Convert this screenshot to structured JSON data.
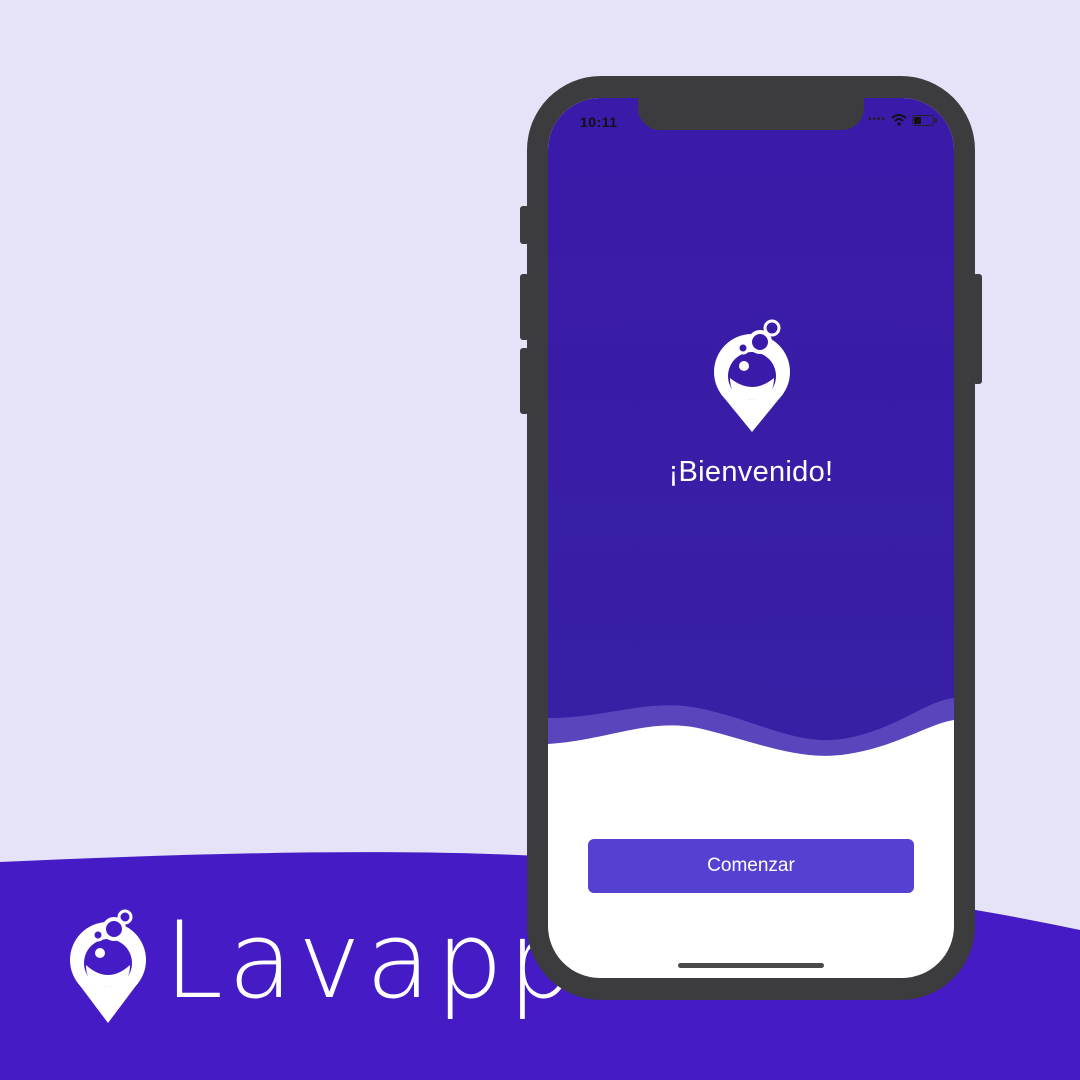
{
  "brand": {
    "name": "Lavapp",
    "logo_icon": "bubble-pin-icon"
  },
  "phone": {
    "status_bar": {
      "time": "10:11",
      "signal_icon": "signal-dots-icon",
      "wifi_icon": "wifi-icon",
      "battery_icon": "battery-icon"
    },
    "screen": {
      "logo_icon": "bubble-pin-icon",
      "welcome_text": "¡Bienvenido!",
      "start_button_label": "Comenzar"
    }
  },
  "colors": {
    "background": "#e6e2f7",
    "brand_purple": "#441bc4",
    "screen_purple": "#3a1aa8",
    "button": "#5441d1",
    "phone_frame": "#3c3c3e"
  }
}
